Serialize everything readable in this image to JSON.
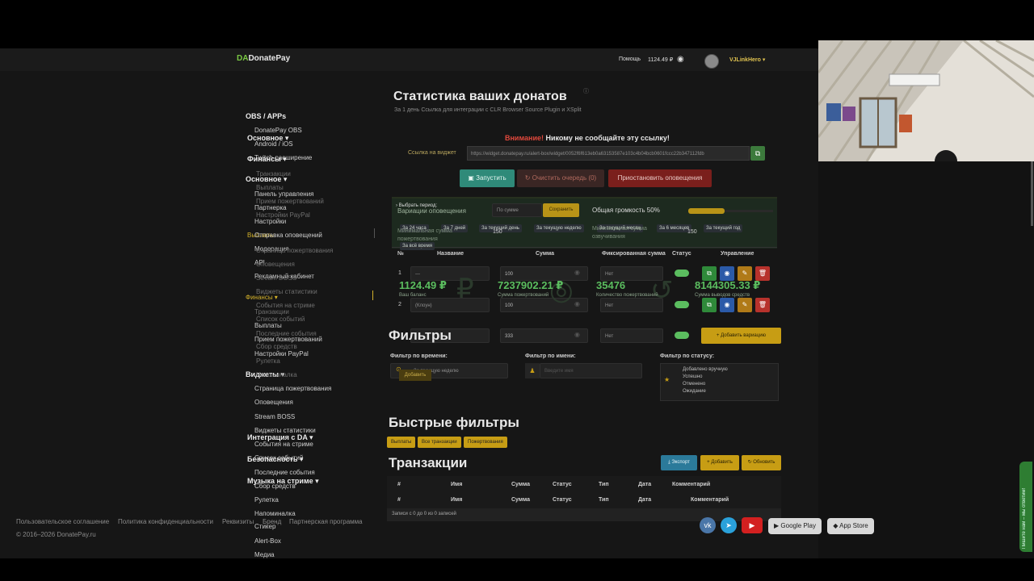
{
  "header": {
    "logo_prefix": "DA",
    "logo": "DonatePay",
    "help": "Помощь",
    "balance": "1124.49 ₽",
    "user": "VJLinkHero"
  },
  "sidebar": {
    "col1": [
      {
        "label": "OBS / APPs",
        "style": "h"
      },
      {
        "label": "DonatePay OBS",
        "style": ""
      },
      {
        "label": "Основное ▾",
        "style": "h"
      },
      {
        "label": "Android / iOS",
        "style": ""
      },
      {
        "label": "Twitch-расширение",
        "style": ""
      },
      {
        "label": "Финансы ▾",
        "style": "h"
      },
      {
        "label": "Транзакции",
        "style": "dim"
      },
      {
        "label": "Основное ▾",
        "style": "h"
      },
      {
        "label": "Выплаты",
        "style": "dim"
      },
      {
        "label": "Панель управления",
        "style": ""
      },
      {
        "label": "Прием пожертвований",
        "style": "dim"
      },
      {
        "label": "Партнерка",
        "style": ""
      },
      {
        "label": "Настройки PayPal",
        "style": "dim"
      },
      {
        "label": "Настройки",
        "style": ""
      },
      {
        "label": "Выплаты",
        "style": "y"
      },
      {
        "label": "Отправка оповещений",
        "style": ""
      },
      {
        "label": "Модерация",
        "style": ""
      },
      {
        "label": "Страница пожертвования",
        "style": "dim"
      },
      {
        "label": "API",
        "style": ""
      },
      {
        "label": "Оповещения",
        "style": "dim"
      },
      {
        "label": "Рекламный кабинет",
        "style": ""
      },
      {
        "label": "Stream BOSS",
        "style": "dim"
      },
      {
        "label": "Виджеты статистики",
        "style": "dim"
      },
      {
        "label": "Финансы ▾",
        "style": "y"
      },
      {
        "label": "События на стриме",
        "style": "dim"
      },
      {
        "label": "Транзакции",
        "style": "dim"
      },
      {
        "label": "Список событий",
        "style": "dim"
      },
      {
        "label": "Выплаты",
        "style": ""
      },
      {
        "label": "Последние события",
        "style": "dim"
      },
      {
        "label": "Прием пожертвований",
        "style": ""
      },
      {
        "label": "Сбор средств",
        "style": "dim"
      },
      {
        "label": "Настройки PayPal",
        "style": ""
      },
      {
        "label": "Рулетка",
        "style": "dim"
      },
      {
        "label": "Виджеты ▾",
        "style": "h"
      },
      {
        "label": "Напоминалка",
        "style": "dim"
      },
      {
        "label": "Страница пожертвования",
        "style": ""
      },
      {
        "label": "Оповещения",
        "style": ""
      },
      {
        "label": "Stream BOSS",
        "style": ""
      },
      {
        "label": "Виджеты статистики",
        "style": ""
      },
      {
        "label": "Интеграция с DA ▾",
        "style": "h"
      },
      {
        "label": "События на стриме",
        "style": ""
      },
      {
        "label": "Безопасность ▾",
        "style": "h"
      },
      {
        "label": "Список событий",
        "style": ""
      },
      {
        "label": "Последние события",
        "style": ""
      },
      {
        "label": "Музыка на стриме ▾",
        "style": "h"
      },
      {
        "label": "Сбор средств",
        "style": ""
      },
      {
        "label": "Рулетка",
        "style": ""
      },
      {
        "label": "Напоминалка",
        "style": ""
      },
      {
        "label": "Стикер",
        "style": ""
      },
      {
        "label": "Alert-Box",
        "style": ""
      },
      {
        "label": "Медиа",
        "style": ""
      }
    ]
  },
  "main": {
    "title": "Статистика ваших донатов",
    "subtitle": "За 1 день",
    "subtitle_overlay": "Ссылка для интеграции с CLR Browser Source Plugin и XSplit",
    "warning_label": "Внимание!",
    "warning_text": " Никому не сообщайте эту ссылку!",
    "link_label": "Ссылка на виджет",
    "link_value": "https://widget.donatepay.ru/alert-box/widget/0052f6f613eb0a63153587e103c4b04bcb0601fccc22b347112fdb",
    "btn_start": "Запустить",
    "btn_clear": "Очистить очередь (0)",
    "btn_pause": "Приостановить оповещения",
    "period_label": "Выбрать период:",
    "variations": "Вариации оповещения",
    "sort_select": "По сумме",
    "save_btn": "Сохранить",
    "volume": "Общая громкость 50%",
    "periods": [
      "За 24 часа",
      "За 7 дней",
      "За текущий день",
      "За текущую неделю",
      "За текущий месяц",
      "За 6 месяцев",
      "За текущий год",
      "За всё время"
    ],
    "min_label": "Минимальная сумма пожертвования",
    "min_value": "150",
    "min2_label": "Минимальная сумма озвучивания",
    "min2_value": "150",
    "stats": [
      {
        "value": "1124.49 ₽",
        "label": "Ваш баланс"
      },
      {
        "value": "7237902.21 ₽",
        "label": "Сумма пожертвований"
      },
      {
        "value": "35476",
        "label": "Количество пожертвований"
      },
      {
        "value": "8144305.33 ₽",
        "label": "Сумма выводов средств"
      }
    ],
    "table_headers": [
      "№",
      "Название",
      "Сумма",
      "Фиксированная сумма",
      "Статус",
      "Управление"
    ],
    "rows": [
      {
        "n": "1",
        "name": "—",
        "sum": "100",
        "fixed": "Нет"
      },
      {
        "n": "2",
        "name": "(Клоун)",
        "sum": "100",
        "fixed": "Нет"
      },
      {
        "n": "",
        "name": "",
        "sum": "333",
        "fixed": "Нет"
      }
    ],
    "add_variation": "Добавить вариацию",
    "filters_title": "Фильтры",
    "filter_time_label": "Фильтр по времени:",
    "filter_time_value": "За текущую неделю",
    "filter_name_label": "Фильтр по имени:",
    "filter_name_placeholder": "Введите имя",
    "filter_status_label": "Фильтр по статусу:",
    "statuses": [
      "Добавлено вручную",
      "Успешно",
      "Отменено",
      "Ожидание"
    ],
    "add_small": "Добавить",
    "quick_title": "Быстрые фильтры",
    "quick": [
      "Выплаты",
      "Все транзакции",
      "Пожертвования"
    ],
    "tx_title": "Транзакции",
    "export": "Экспорт",
    "add": "Добавить",
    "refresh": "Обновить",
    "tx_headers": [
      "#",
      "Имя",
      "Сумма",
      "Статус",
      "Тип",
      "Дата",
      "Комментарий"
    ],
    "tx_empty": "Записи с 0 до 0 из 0 записей"
  },
  "footer": {
    "links": [
      "Пользовательское соглашение",
      "Политика конфиденциальности",
      "Реквизиты",
      "Бренд",
      "Партнерская программа"
    ],
    "copy": "© 2016–2026 DonatePay.ru",
    "google": "Google Play",
    "apple": "App Store",
    "feedback": "Пишите нам – мы ответим!"
  },
  "colors": {
    "accent": "#5bbd5f",
    "warn": "#e0483c",
    "yellow": "#c79d14",
    "sidebar_yellow": "#d2b02a"
  }
}
